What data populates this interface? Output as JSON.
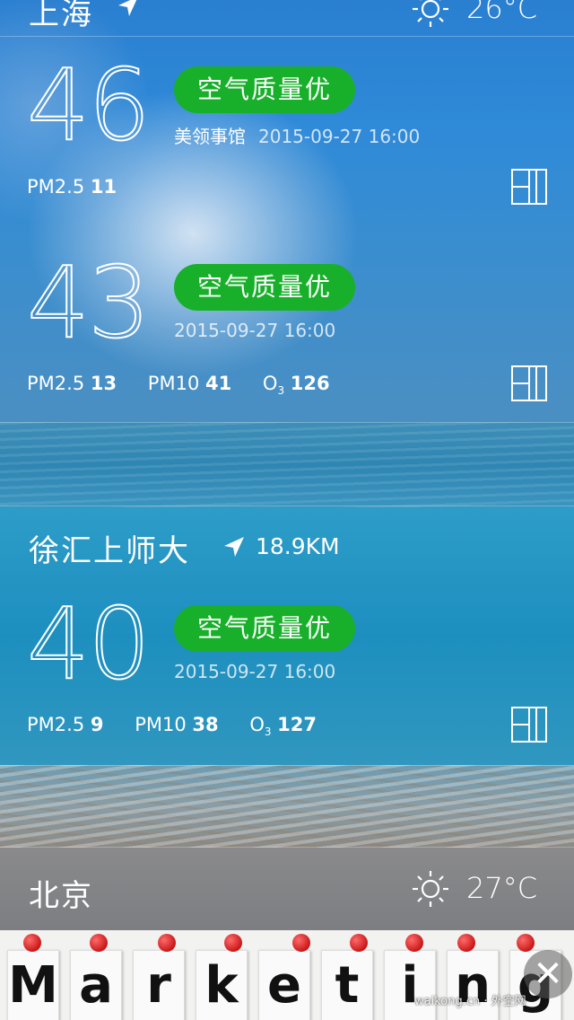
{
  "header": {
    "city": "上海",
    "temperature": "26°C",
    "icon": "sun-icon"
  },
  "stations": [
    {
      "aqi": "46",
      "quality": "空气质量优",
      "station_name": "美领事馆",
      "time": "2015-09-27 16:00",
      "pm25_label": "PM2.5",
      "pm25": "11"
    },
    {
      "aqi": "43",
      "quality": "空气质量优",
      "time": "2015-09-27 16:00",
      "pm25_label": "PM2.5",
      "pm25": "13",
      "pm10_label": "PM10",
      "pm10": "41",
      "o3_label": "O",
      "o3_sub": "3",
      "o3": "126"
    }
  ],
  "nearby": {
    "name": "徐汇上师大",
    "distance": "18.9KM",
    "aqi": "40",
    "quality": "空气质量优",
    "time": "2015-09-27 16:00",
    "pm25_label": "PM2.5",
    "pm25": "9",
    "pm10_label": "PM10",
    "pm10": "38",
    "o3_label": "O",
    "o3_sub": "3",
    "o3": "127"
  },
  "next_city": {
    "city": "北京",
    "temperature": "27°C",
    "icon": "sun-icon"
  },
  "ad": {
    "letters": [
      "M",
      "a",
      "r",
      "k",
      "e",
      "t",
      "i",
      "n",
      "g"
    ],
    "watermark": "waikong.cn · 外空网",
    "close_label": "✕"
  },
  "colors": {
    "badge": "#18b02a",
    "top_bg": "#2a7fd0",
    "mid_bg": "#1d8fbf"
  }
}
